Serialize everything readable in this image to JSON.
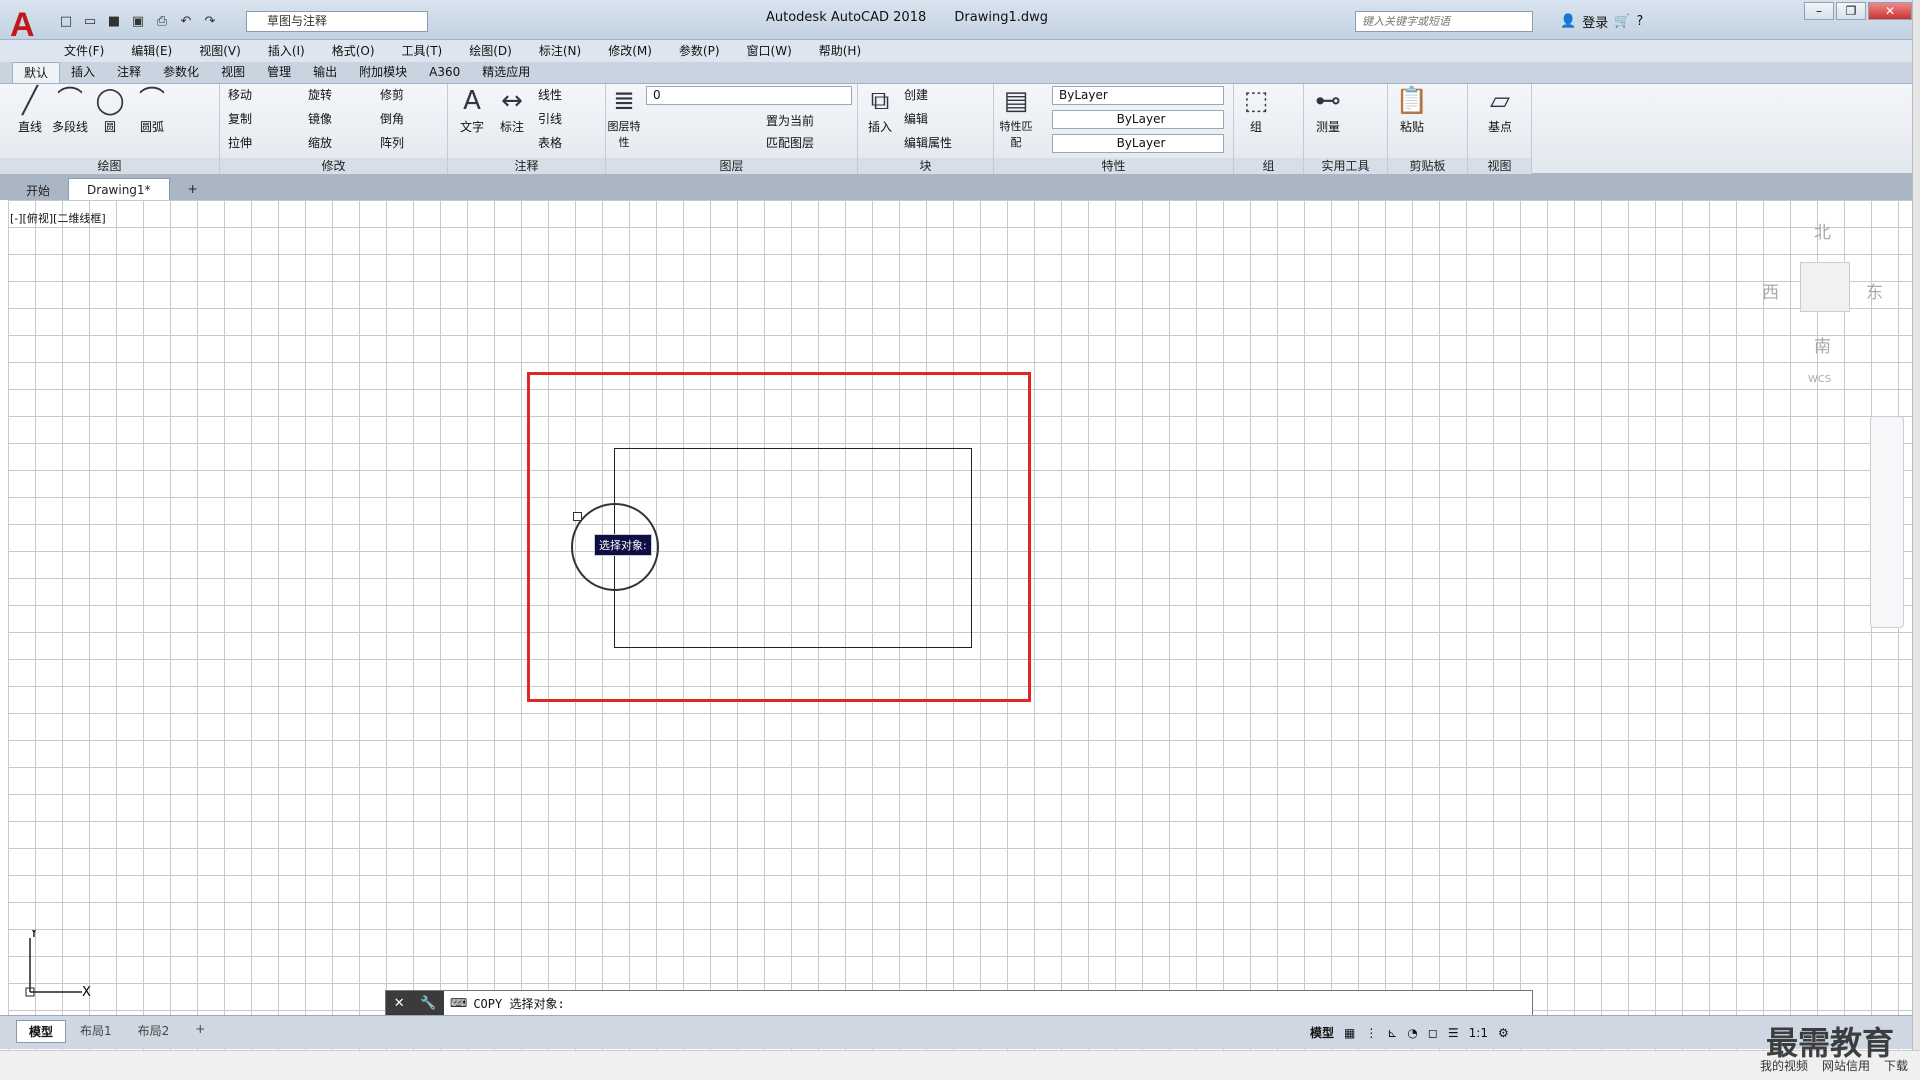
{
  "app": {
    "title": "Autodesk AutoCAD 2018",
    "file": "Drawing1.dwg",
    "logo": "A",
    "workspace": "草图与注释",
    "search_placeholder": "键入关键字或短语",
    "login": "登录"
  },
  "menus": [
    "文件(F)",
    "编辑(E)",
    "视图(V)",
    "插入(I)",
    "格式(O)",
    "工具(T)",
    "绘图(D)",
    "标注(N)",
    "修改(M)",
    "参数(P)",
    "窗口(W)",
    "帮助(H)"
  ],
  "ribbon_tabs": [
    "默认",
    "插入",
    "注释",
    "参数化",
    "视图",
    "管理",
    "输出",
    "附加模块",
    "A360",
    "精选应用"
  ],
  "panels": {
    "draw": {
      "title": "绘图",
      "line": "直线",
      "polyline": "多段线",
      "circle": "圆",
      "arc": "圆弧"
    },
    "modify": {
      "title": "修改",
      "move": "移动",
      "rotate": "旋转",
      "trim": "修剪",
      "copy": "复制",
      "mirror": "镜像",
      "fillet": "倒角",
      "stretch": "拉伸",
      "scale": "缩放",
      "array": "阵列"
    },
    "annotation": {
      "title": "注释",
      "text": "文字",
      "dim": "标注",
      "linear": "线性",
      "leader": "引线",
      "table": "表格"
    },
    "layers": {
      "title": "图层",
      "props": "图层特性",
      "current_layer": "0",
      "set_current": "置为当前",
      "match": "匹配图层"
    },
    "block": {
      "title": "块",
      "insert": "插入",
      "create": "创建",
      "edit": "编辑",
      "edit_attr": "编辑属性"
    },
    "properties": {
      "title": "特性",
      "match": "特性匹配",
      "color": "ByLayer",
      "linetype": "ByLayer",
      "lineweight": "ByLayer"
    },
    "groups": {
      "title": "组",
      "group": "组"
    },
    "utilities": {
      "title": "实用工具",
      "measure": "测量"
    },
    "clipboard": {
      "title": "剪贴板",
      "paste": "粘贴"
    },
    "view": {
      "title": "视图",
      "base": "基点"
    }
  },
  "doc_tabs": [
    "开始",
    "Drawing1*"
  ],
  "viewport_label": "[-][俯视][二维线框]",
  "viewcube": {
    "n": "北",
    "s": "南",
    "e": "东",
    "w": "西",
    "wcs": "WCS"
  },
  "tooltip": "选择对象:",
  "ucs": {
    "x": "X",
    "y": "Y"
  },
  "command_line": "COPY 选择对象:",
  "layout_tabs": [
    "模型",
    "布局1",
    "布局2"
  ],
  "status": {
    "model": "模型",
    "scale": "1:1"
  },
  "taskbar": [
    "我的视频",
    "网站信用",
    "下载"
  ],
  "watermark": "最需教育"
}
